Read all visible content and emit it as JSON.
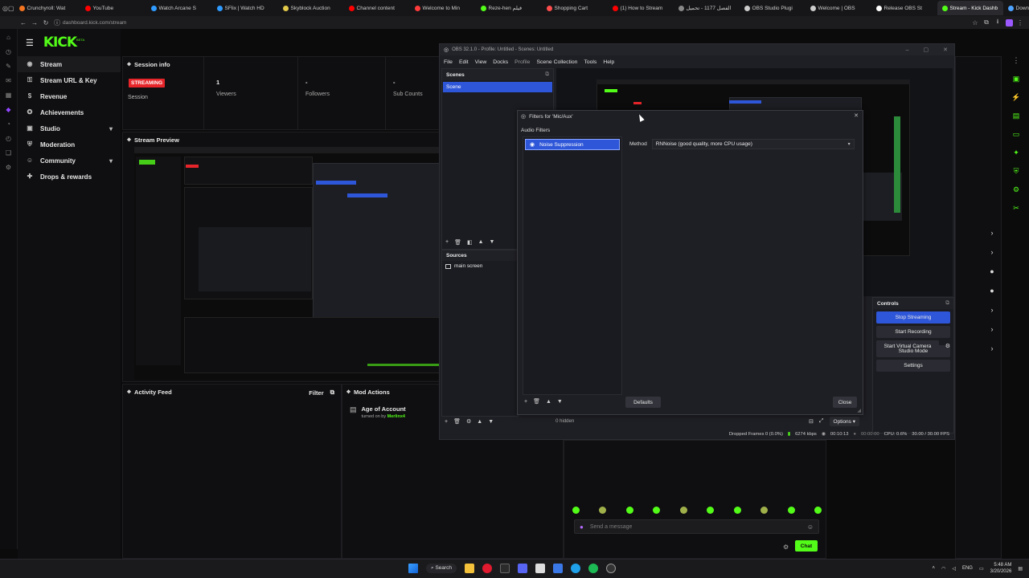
{
  "browser": {
    "tabs": [
      {
        "label": "Crunchyroll: Wat",
        "color": "#f47521"
      },
      {
        "label": "YouTube",
        "color": "#ff0000"
      },
      {
        "label": "Watch Arcane S",
        "color": "#2f9bff"
      },
      {
        "label": "SFlix | Watch HD",
        "color": "#2f9bff"
      },
      {
        "label": "Skyblock Auction",
        "color": "#e2c94a"
      },
      {
        "label": "Channel content",
        "color": "#ff0000"
      },
      {
        "label": "Welcome to Min",
        "color": "#ff3b3b"
      },
      {
        "label": "Reze-hen فيلم",
        "color": "#53fc18"
      },
      {
        "label": "Shopping Cart",
        "color": "#ff4d4d"
      },
      {
        "label": "(1) How to Stream",
        "color": "#ff0000"
      },
      {
        "label": "الفصل 1177 - تحميل",
        "color": "#888888"
      },
      {
        "label": "OBS Studio Plugi",
        "color": "#cccccc"
      },
      {
        "label": "Welcome | OBS",
        "color": "#cccccc"
      },
      {
        "label": "Release OBS St",
        "color": "#ffffff"
      },
      {
        "label": "Stream - Kick Dashb",
        "color": "#53fc18"
      },
      {
        "label": "Download Altern",
        "color": "#4da3ff"
      }
    ],
    "url": "dashboard.kick.com/stream"
  },
  "kick": {
    "logo": "KICK",
    "logo_sup": "BETA",
    "nav": [
      {
        "label": "Stream",
        "icon": "broadcast-icon",
        "glyph": "◉"
      },
      {
        "label": "Stream URL & Key",
        "icon": "key-icon",
        "glyph": "⚿"
      },
      {
        "label": "Revenue",
        "icon": "dollar-icon",
        "glyph": "$"
      },
      {
        "label": "Achievements",
        "icon": "trophy-icon",
        "glyph": "✪"
      },
      {
        "label": "Studio",
        "icon": "studio-icon",
        "glyph": "▣"
      },
      {
        "label": "Moderation",
        "icon": "shield-icon",
        "glyph": "⛨"
      },
      {
        "label": "Community",
        "icon": "users-icon",
        "glyph": "☺"
      },
      {
        "label": "Drops & rewards",
        "icon": "gift-icon",
        "glyph": "✚"
      }
    ],
    "session": {
      "title": "Session info",
      "badge": "STREAMING",
      "session_label": "Session",
      "stats": [
        {
          "value": "1",
          "label": "Viewers"
        },
        {
          "value": "-",
          "label": "Followers"
        },
        {
          "value": "-",
          "label": "Sub Counts"
        }
      ]
    },
    "preview_title": "Stream Preview",
    "activity": {
      "title": "Activity Feed",
      "filter": "Filter"
    },
    "mod": {
      "title": "Mod Actions",
      "item_title": "Age of Account",
      "item_sub": "turned on by",
      "item_user": "Merlinx4"
    },
    "chat": {
      "placeholder": "Send a message",
      "button": "Chat"
    }
  },
  "obs": {
    "title": "OBS 32.1.0 - Profile: Untitled - Scenes: Untitled",
    "menu": [
      "File",
      "Edit",
      "View",
      "Docks",
      "Profile",
      "Scene Collection",
      "Tools",
      "Help"
    ],
    "scenes_title": "Scenes",
    "scenes": [
      "Scene"
    ],
    "sources_title": "Sources",
    "sources": [
      "main screen"
    ],
    "mixer_hidden": "0 hidden",
    "mixer_options": "Options",
    "controls_title": "Controls",
    "controls": [
      "Stop Streaming",
      "Start Recording",
      "Start Virtual Camera",
      "Studio Mode",
      "Settings"
    ],
    "status": {
      "dropped": "Dropped Frames 0 (0.0%)",
      "kbps": "6274 kbps",
      "live_time": "00:10:13",
      "rec_time": "00:00:00",
      "cpu": "CPU: 0.6%",
      "fps": "30.00 / 30.00 FPS"
    }
  },
  "filters": {
    "title": "Filters for 'Mic/Aux'",
    "section": "Audio Filters",
    "items": [
      "Noise Suppression"
    ],
    "method_label": "Method",
    "method_value": "RNNoise (good quality, more CPU usage)",
    "defaults": "Defaults",
    "close": "Close"
  },
  "taskbar": {
    "search": "Search",
    "lang": "ENG",
    "time": "5:48 AM",
    "date": "3/20/2026"
  },
  "colors": {
    "kick_green": "#53fc18",
    "obs_blue": "#2e56d8",
    "streaming_red": "#e5252a"
  }
}
